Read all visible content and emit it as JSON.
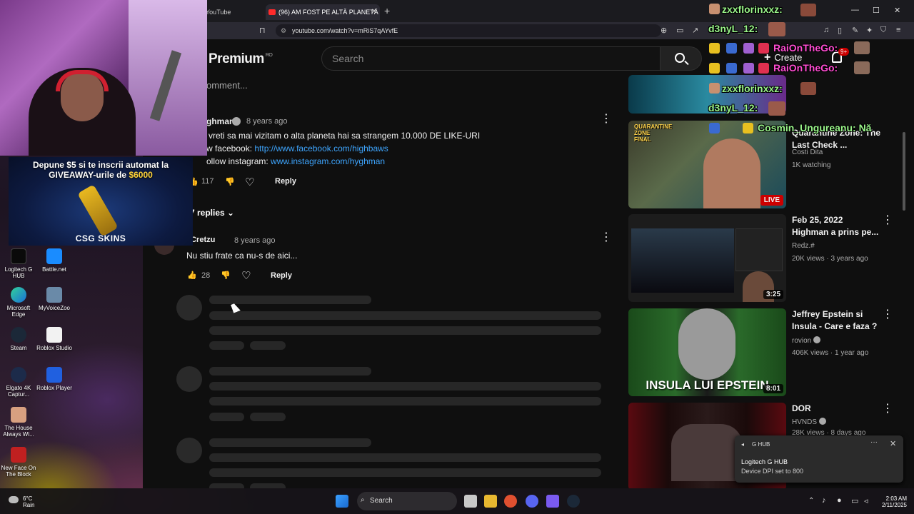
{
  "browser": {
    "tabs": [
      {
        "label": "YouTube"
      },
      {
        "label": "(96) AM FOST PE ALTĂ PLANETĂ"
      }
    ],
    "url": "youtube.com/watch?v=mRiS7qAYvfE"
  },
  "youtube": {
    "logo_text": "Premium",
    "logo_region": "RO",
    "search_placeholder": "Search",
    "create_label": "Create",
    "notif_count": "9+"
  },
  "comments": {
    "add_placeholder": "omment...",
    "main": {
      "author": "ghman",
      "time": "8 years ago",
      "lines": [
        "vreti sa mai vizitam o alta planeta hai sa strangem 10.000 DE LIKE-URI",
        "w facebook: ",
        "ollow instagram: "
      ],
      "facebook_link": "http://www.facebook.com/highbaws",
      "instagram_link": "www.instagram.com/hyghman",
      "likes": "117",
      "reply_label": "Reply",
      "replies_toggle": "7 replies"
    },
    "reply": {
      "author": "xCretzu",
      "time": "8 years ago",
      "text": "Nu stiu frate ca nu-s de aici...",
      "likes": "28",
      "reply_label": "Reply"
    }
  },
  "sidebar_videos": [
    {
      "title": "Quarantine Zone: The Last Check ...",
      "channel": "Costi Dita",
      "meta": "1K watching",
      "badge": "LIVE"
    },
    {
      "title": "Feb 25, 2022 Highman a prins pe...",
      "channel": "Redz.#",
      "meta": "20K views · 3 years ago",
      "duration": "3:25"
    },
    {
      "title": "Jeffrey Epstein si Insula - Care e faza ?",
      "channel": "rovion",
      "meta": "406K views · 1 year ago",
      "duration": "8:01",
      "thumb_text": "INSULA LUI EPSTEIN"
    },
    {
      "title": "DOR",
      "channel": "HVNDS",
      "meta": "28K views · 8 days ago"
    }
  ],
  "overlay": {
    "alerts": [
      "zxxflorinxxz:",
      "d3nyL_12:",
      "RaiOnTheGo:",
      "RaiOnTheGo:",
      "zxxflorinxxz:",
      "d3nyL_12:",
      "Cosmin_Ungureanu: Nă"
    ],
    "giveaway_line1": "Depune $5 si te inscrii automat la",
    "giveaway_line2a": "GIVEAWAY-urile de ",
    "giveaway_amount": "$6000",
    "giveaway_brand": "CSG SKINS"
  },
  "desktop_icons": [
    {
      "label": "Logitech G HUB"
    },
    {
      "label": "Battle.net"
    },
    {
      "label": "Microsoft Edge"
    },
    {
      "label": "MyVoiceZoo"
    },
    {
      "label": "Steam"
    },
    {
      "label": "Roblox Studio"
    },
    {
      "label": "Elgato 4K Captur..."
    },
    {
      "label": "Roblox Player"
    },
    {
      "label": "The House Always Wi..."
    },
    {
      "label": "New Face On The Block"
    }
  ],
  "notification": {
    "app": "G HUB",
    "title": "Logitech G HUB",
    "body": "Device DPI set to 800"
  },
  "taskbar": {
    "weather_temp": "6°C",
    "weather_desc": "Rain",
    "search_label": "Search",
    "time": "2:03 AM",
    "date": "2/11/2025"
  },
  "colors": {
    "accent_link": "#3ea6ff",
    "live_red": "#cc0000",
    "chat_green": "#9af58a"
  }
}
